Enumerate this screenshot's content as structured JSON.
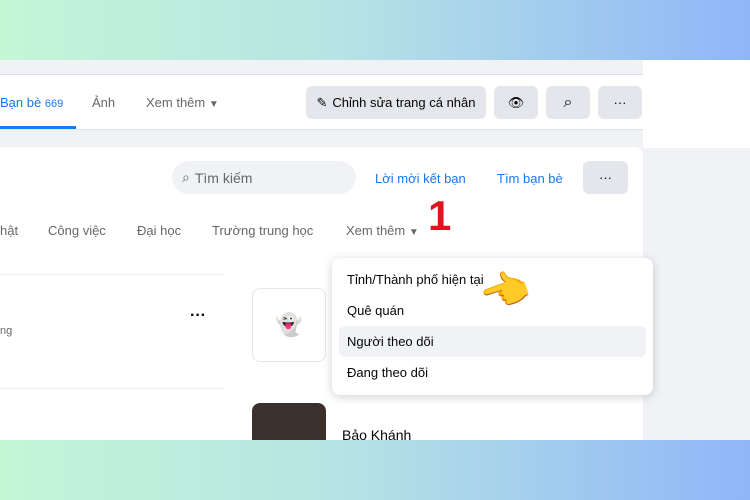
{
  "profile_tabs": {
    "friends_label": "Bạn bè",
    "friends_count": "669",
    "photos": "Ảnh",
    "more": "Xem thêm"
  },
  "actions": {
    "edit_profile": "Chỉnh sửa trang cá nhân"
  },
  "friends_card": {
    "search_placeholder": "Tìm kiếm",
    "friend_requests": "Lời mời kết bạn",
    "find_friends": "Tìm bạn bè",
    "filters": [
      "hật",
      "Công việc",
      "Đại học",
      "Trường trung học",
      "Xem thêm"
    ]
  },
  "annotation": "1",
  "list": {
    "partial_subtext": "ng",
    "friend_name": "Bảo Khánh"
  },
  "dropdown": {
    "items": [
      "Tỉnh/Thành phố hiện tại",
      "Quê quán",
      "Người theo dõi",
      "Đang theo dõi"
    ],
    "highlighted": 2
  },
  "colors": {
    "accent": "#1877f2",
    "annotation": "#e0141e"
  }
}
